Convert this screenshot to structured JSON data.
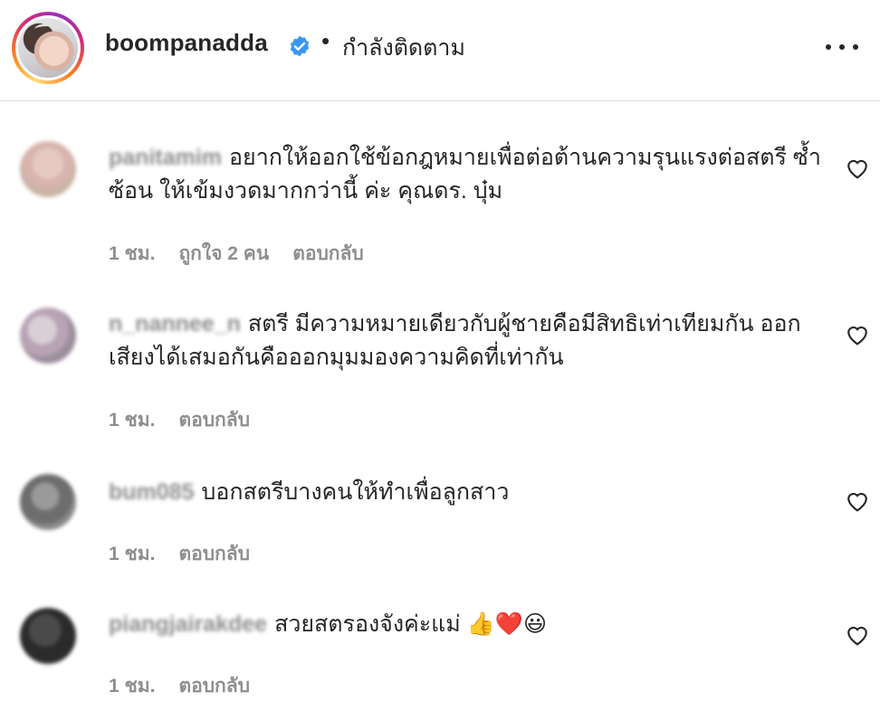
{
  "header": {
    "username": "boompanadda",
    "separator": "•",
    "follow_status": "กำลังติดตาม",
    "icons": [
      "avatar",
      "verified-badge-icon",
      "more-icon"
    ],
    "verified_color": "#3897f0"
  },
  "comments": [
    {
      "username": "panitamim",
      "text": "อยากให้ออกใช้ข้อกฎหมายเพื่อต่อต้านความรุนแรงต่อสตรี ซ้ำซ้อน ให้เข้มงวดมากกว่านี้ ค่ะ คุณดร. บุ๋ม",
      "time": "1 ชม.",
      "likes": "ถูกใจ 2 คน",
      "reply": "ตอบกลับ"
    },
    {
      "username": "n_nannee_n",
      "text": "สตรี มีความหมายเดียวกับผู้ชายคือมีสิทธิเท่าเทียมกัน ออกเสียงได้เสมอกันคือออกมุมมองความคิดที่เท่ากัน",
      "time": "1 ชม.",
      "reply": "ตอบกลับ"
    },
    {
      "username": "bum085",
      "text": "บอกสตรีบางคนให้ทำเพื่อลูกสาว",
      "time": "1 ชม.",
      "reply": "ตอบกลับ"
    },
    {
      "username": "piangjairakdee",
      "text": "สวยสตรองจังค่ะแม่ 👍❤️😃",
      "time": "1 ชม.",
      "reply": "ตอบกลับ"
    }
  ]
}
